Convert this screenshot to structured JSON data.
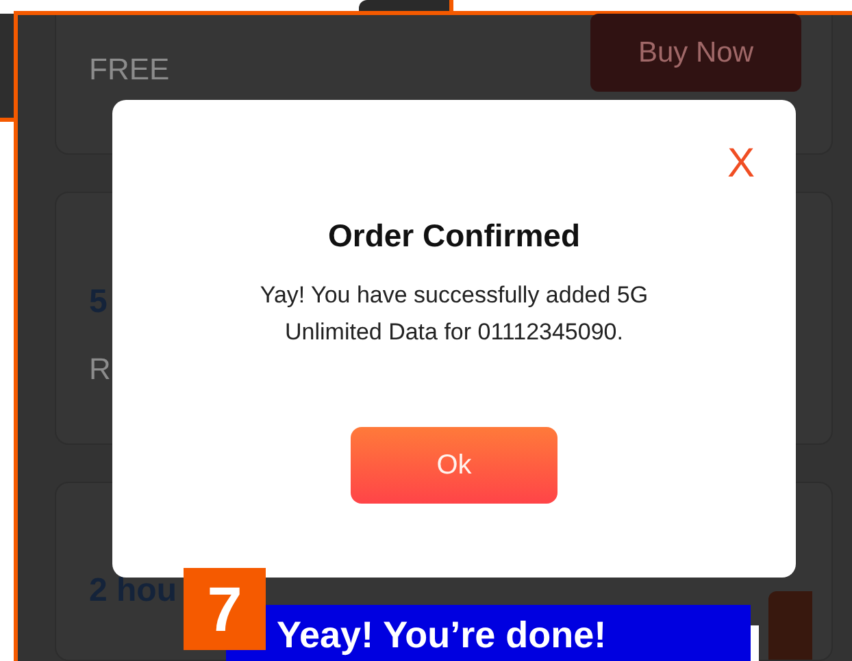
{
  "plans": [
    {
      "price": "FREE",
      "button": "Buy Now"
    },
    {
      "title": "5",
      "subtitle": "R"
    },
    {
      "title": "2 hou"
    }
  ],
  "modal": {
    "close": "X",
    "title": "Order Confirmed",
    "message": "Yay! You have successfully added 5G Unlimited Data for 01112345090.",
    "button": "Ok"
  },
  "tutorial": {
    "step": "7",
    "caption": "Yeay! You’re done!"
  }
}
